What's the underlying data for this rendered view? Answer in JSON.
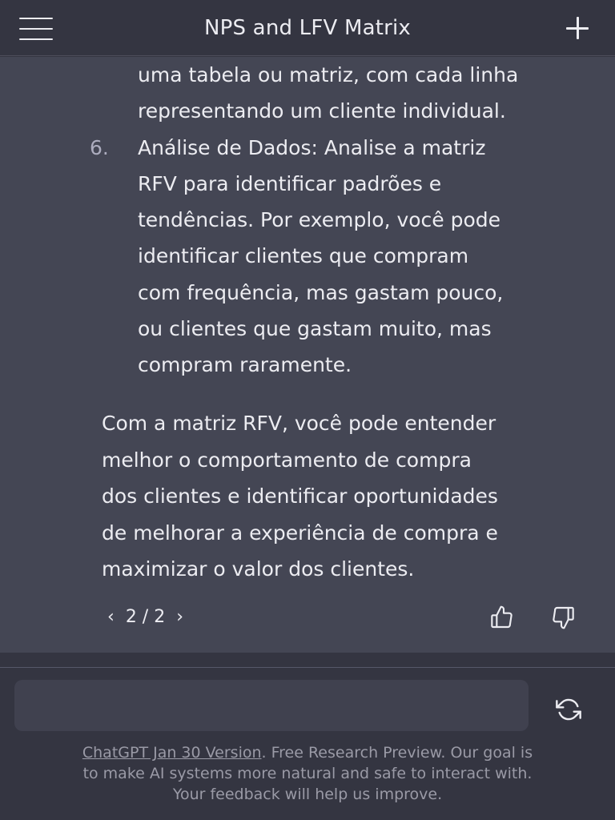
{
  "header": {
    "title": "NPS and LFV Matrix",
    "menu_icon": "hamburger-menu-icon",
    "new_chat_icon": "plus-icon"
  },
  "message": {
    "list_continuation": [
      "uma tabela ou matriz, com cada linha",
      "representando um cliente individual."
    ],
    "list_item": {
      "number": "6.",
      "lines": [
        "Análise de Dados: Analise a matriz",
        "RFV para identificar padrões e",
        "tendências. Por exemplo, você pode",
        "identificar clientes que compram",
        "com frequência, mas gastam pouco,",
        "ou clientes que gastam muito, mas",
        "compram raramente."
      ]
    },
    "paragraph_lines": [
      "Com a matriz RFV, você pode entender",
      "melhor o comportamento de compra",
      "dos clientes e identificar oportunidades",
      "de melhorar a experiência de compra e",
      "maximizar o valor dos clientes."
    ],
    "pager": {
      "prev": "‹",
      "count": "2 / 2",
      "next": "›"
    },
    "feedback_icons": [
      "thumbs-up-icon",
      "thumbs-down-icon"
    ]
  },
  "composer": {
    "input_value": "",
    "send_icon": "send-icon",
    "regenerate_icon": "regenerate-icon"
  },
  "footer": {
    "link_text": "ChatGPT Jan 30 Version",
    "rest_line1": ". Free Research Preview. Our goal is",
    "line2": "to make AI systems more natural and safe to interact with.",
    "line3": "Your feedback will help us improve."
  }
}
